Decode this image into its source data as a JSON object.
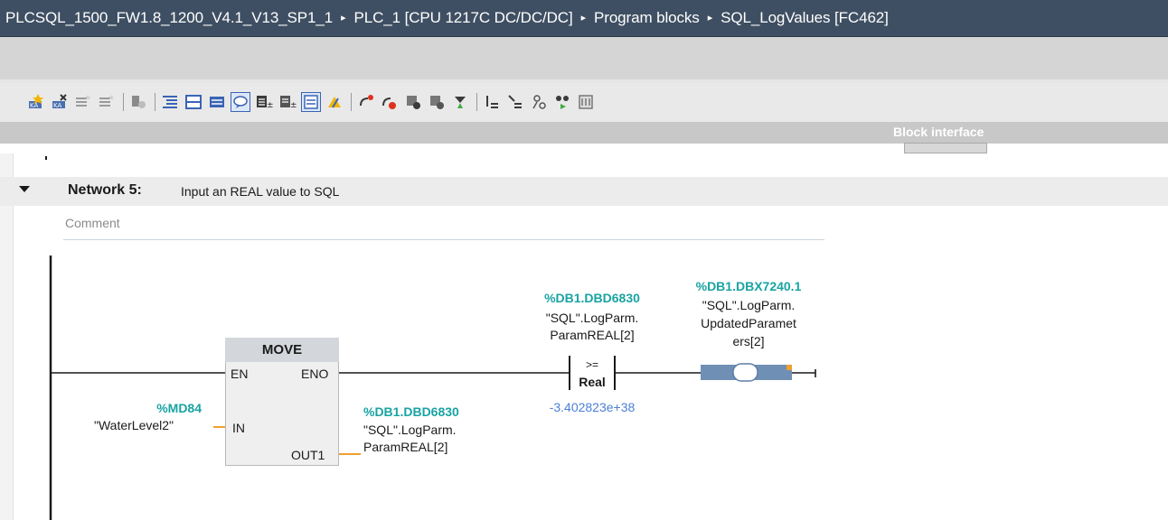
{
  "breadcrumb": {
    "items": [
      "PLCSQL_1500_FW1.8_1200_V4.1_V13_SP1_1",
      "PLC_1 [CPU 1217C DC/DC/DC]",
      "Program blocks",
      "SQL_LogValues [FC462]"
    ],
    "separator": "▸"
  },
  "toolbar": {
    "icons": [
      "insert-network-icon",
      "delete-network-icon",
      "insert-row-icon",
      "append-row-icon",
      "reset-start-values-icon",
      "open-all-networks-icon",
      "close-all-networks-icon",
      "abs-operands-icon",
      "network-comments-icon",
      "favorites-icon",
      "download-icon",
      "upload-icon",
      "block-window-icon",
      "monitor-block-icon",
      "go-to-error-icon",
      "breakpoint-icon",
      "status-icon",
      "tag-info-icon",
      "compare-icon",
      "instruction-list-icon",
      "profile-icon",
      "debug-icon",
      "watch-icon",
      "help-icon"
    ]
  },
  "interface_panel": {
    "label": "Block interface"
  },
  "network": {
    "title": "Network 5:",
    "description": "Input an REAL value to SQL",
    "comment_placeholder": "Comment"
  },
  "move_block": {
    "title": "MOVE",
    "pin_en": "EN",
    "pin_eno": "ENO",
    "pin_in": "IN",
    "pin_out": "OUT1",
    "in_address": "%MD84",
    "in_symbol": "\"WaterLevel2\"",
    "out_address": "%DB1.DBD6830",
    "out_symbol_line1": "\"SQL\".LogParm.",
    "out_symbol_line2": "ParamREAL[2]"
  },
  "compare_block": {
    "operator": ">=",
    "type": "Real",
    "address": "%DB1.DBD6830",
    "symbol_line1": "\"SQL\".LogParm.",
    "symbol_line2": "ParamREAL[2]",
    "compare_value": "-3.402823e+38"
  },
  "coil": {
    "address": "%DB1.DBX7240.1",
    "symbol_line1": "\"SQL\".LogParm.",
    "symbol_line2": "UpdatedParamet",
    "symbol_line3": "ers[2]"
  },
  "colors": {
    "titlebar": "#3f4f63",
    "operand_address": "#1aa3a3",
    "constant_value": "#4c7fd6",
    "accent_orange": "#f0a030"
  }
}
